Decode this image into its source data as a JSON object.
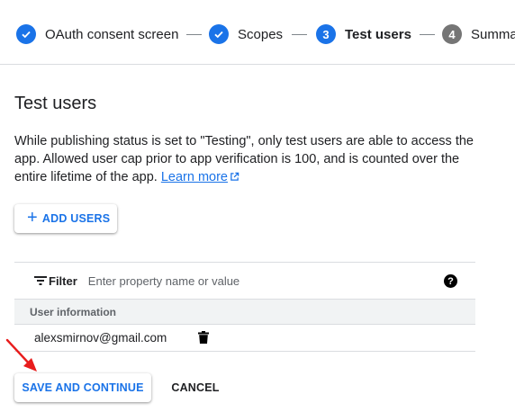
{
  "stepper": {
    "steps": [
      {
        "number": "✓",
        "label": "OAuth consent screen",
        "state": "done"
      },
      {
        "number": "✓",
        "label": "Scopes",
        "state": "done"
      },
      {
        "number": "3",
        "label": "Test users",
        "state": "active"
      },
      {
        "number": "4",
        "label": "Summa",
        "state": "pending"
      }
    ]
  },
  "section": {
    "title": "Test users",
    "description": "While publishing status is set to \"Testing\", only test users are able to access the app. Allowed user cap prior to app verification is 100, and is counted over the entire lifetime of the app.",
    "learn_more": "Learn more"
  },
  "add_users_button": {
    "icon": "plus-icon",
    "label": "ADD USERS"
  },
  "filter": {
    "label": "Filter",
    "placeholder": "Enter property name or value",
    "help_icon": "?"
  },
  "table": {
    "columns": [
      "User information"
    ],
    "rows": [
      {
        "email": "alexsmirnov@gmail.com"
      }
    ]
  },
  "footer": {
    "save_label": "SAVE AND CONTINUE",
    "cancel_label": "CANCEL"
  },
  "colors": {
    "accent": "#1a73e8",
    "pending": "#757575",
    "annotation_arrow": "#e81c1c"
  }
}
